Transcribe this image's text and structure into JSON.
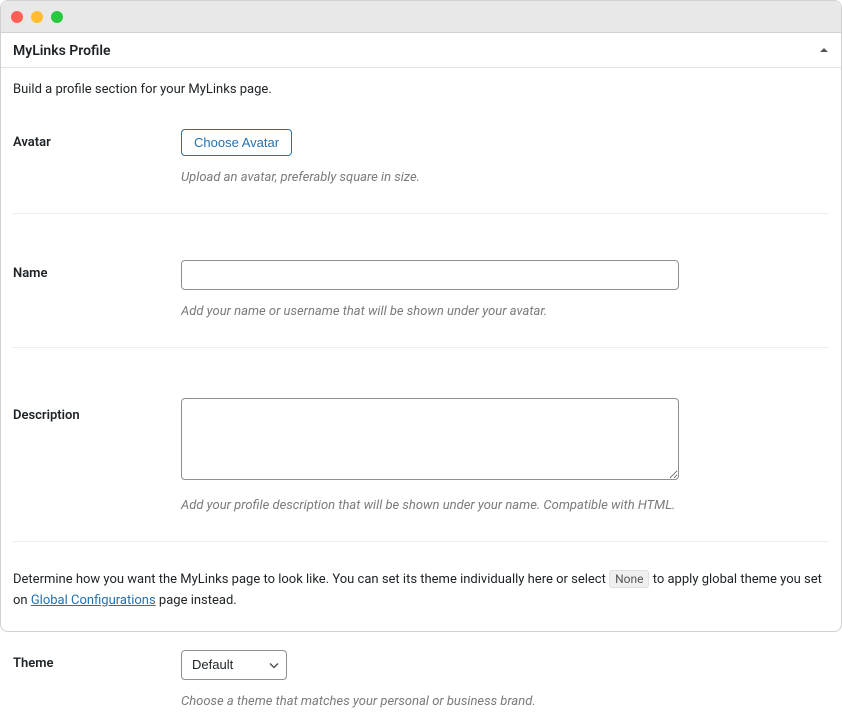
{
  "panel": {
    "title": "MyLinks Profile",
    "intro": "Build a profile section for your MyLinks page."
  },
  "avatar": {
    "label": "Avatar",
    "button": "Choose Avatar",
    "help": "Upload an avatar, preferably square in size."
  },
  "name": {
    "label": "Name",
    "value": "",
    "help": "Add your name or username that will be shown under your avatar."
  },
  "description": {
    "label": "Description",
    "value": "",
    "help": "Add your profile description that will be shown under your name. Compatible with HTML."
  },
  "theme_section": {
    "text_before": "Determine how you want the MyLinks page to look like. You can set its theme individually here or select ",
    "badge": "None",
    "text_mid": " to apply global theme you set on ",
    "link": "Global Configurations",
    "text_after": " page instead."
  },
  "theme": {
    "label": "Theme",
    "selected": "Default",
    "help": "Choose a theme that matches your personal or business brand."
  }
}
